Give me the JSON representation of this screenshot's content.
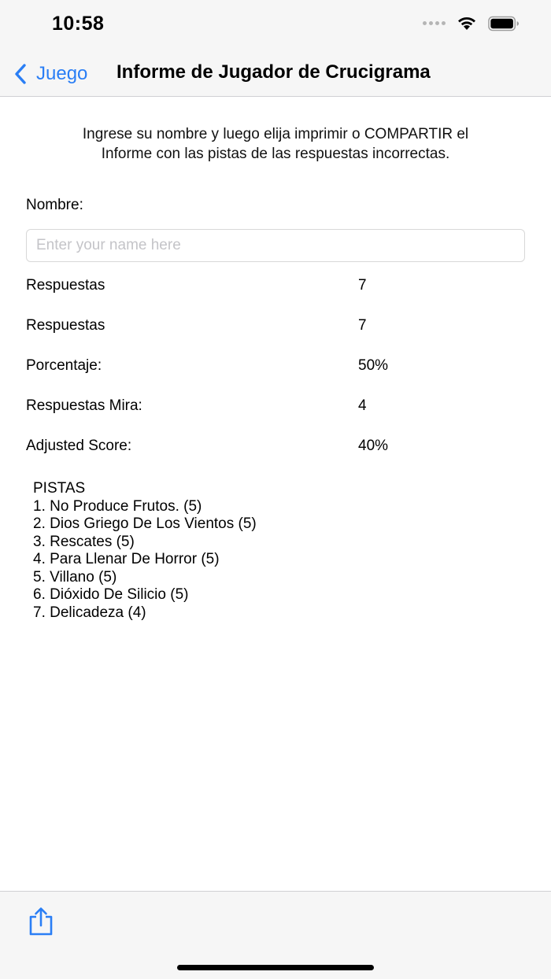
{
  "status_bar": {
    "time": "10:58",
    "icons": [
      "signal-icon",
      "wifi-icon",
      "battery-icon"
    ]
  },
  "nav": {
    "back_label": "Juego",
    "title": "Informe de Jugador de Crucigrama",
    "accent_color": "#2a7ef5"
  },
  "instructions": {
    "line1": "Ingrese su nombre y luego elija imprimir o COMPARTIR el",
    "line2": "Informe con las pistas de las respuestas incorrectas."
  },
  "name_field": {
    "label": "Nombre:",
    "placeholder": "Enter your name here",
    "value": ""
  },
  "stats": [
    {
      "label": "Respuestas",
      "value": "7"
    },
    {
      "label": "Respuestas",
      "value": "7"
    },
    {
      "label": "Porcentaje:",
      "value": "50%"
    },
    {
      "label": "Respuestas Mira:",
      "value": "4"
    },
    {
      "label": "Adjusted Score:",
      "value": "40%"
    }
  ],
  "clues": {
    "heading": "PISTAS",
    "items": [
      "1. No Produce Frutos. (5)",
      "2. Dios Griego De Los Vientos (5)",
      "3. Rescates (5)",
      "4. Para Llenar De Horror (5)",
      "5. Villano (5)",
      "6. Dióxido De Silicio (5)",
      "7. Delicadeza (4)"
    ]
  },
  "toolbar": {
    "share_icon": "share-icon"
  }
}
